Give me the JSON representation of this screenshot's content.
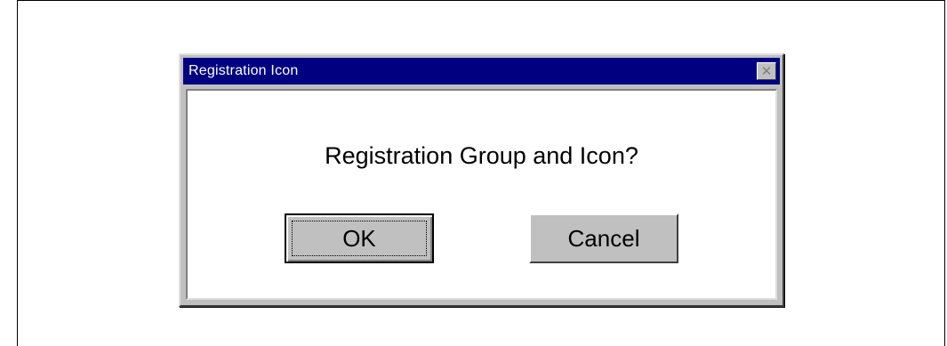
{
  "dialog": {
    "title": "Registration Icon",
    "close_icon": "close-icon",
    "message": "Registration Group and Icon?",
    "buttons": {
      "ok_label": "OK",
      "cancel_label": "Cancel"
    }
  },
  "colors": {
    "titlebar": "#000080",
    "dialog_face": "#c0c0c0",
    "client_bg": "#ffffff"
  }
}
